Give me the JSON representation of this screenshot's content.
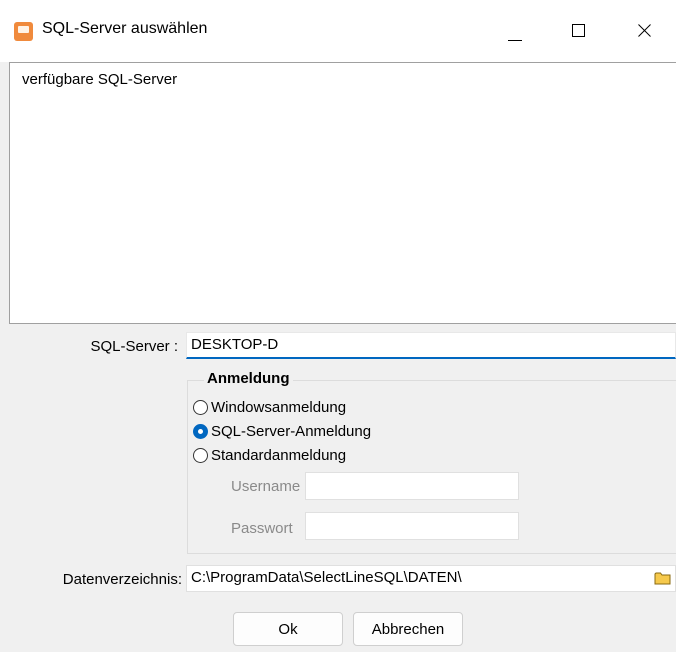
{
  "window": {
    "title": "SQL-Server auswählen"
  },
  "server_list": {
    "header": "verfügbare SQL-Server"
  },
  "sql_server": {
    "label": "SQL-Server :",
    "value": "DESKTOP-D"
  },
  "login_group": {
    "title": "Anmeldung",
    "options": [
      {
        "label": "Windowsanmeldung",
        "checked": false
      },
      {
        "label": "SQL-Server-Anmeldung",
        "checked": true
      },
      {
        "label": "Standardanmeldung",
        "checked": false
      }
    ],
    "username_label": "Username",
    "password_label": "Passwort"
  },
  "data_dir": {
    "label": "Datenverzeichnis:",
    "value": "C:\\ProgramData\\SelectLineSQL\\DATEN\\"
  },
  "buttons": {
    "ok": "Ok",
    "cancel": "Abbrechen"
  },
  "colors": {
    "accent": "#0067c0",
    "app_icon": "#f08a3c",
    "folder": "#f6c94c"
  }
}
